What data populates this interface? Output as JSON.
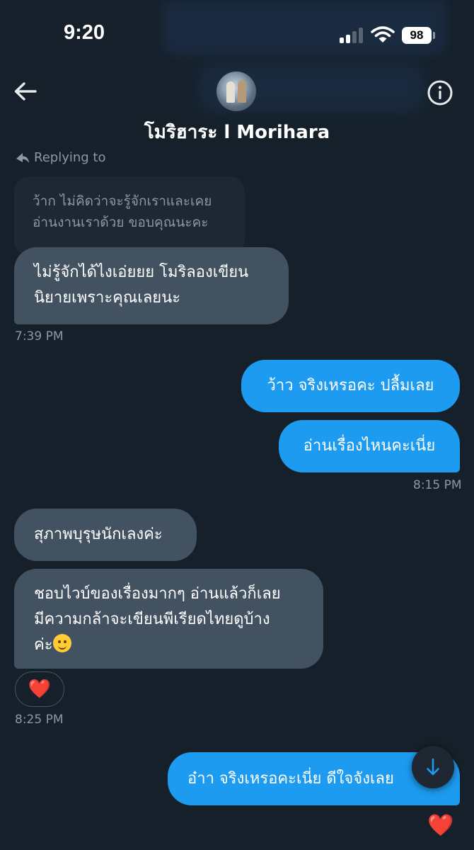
{
  "status_bar": {
    "time": "9:20",
    "battery": "98"
  },
  "header": {
    "contact_name": "โมริฮาระ l Morihara"
  },
  "reply": {
    "label": "Replying to",
    "quoted_lines": [
      "ว้าก ไม่คิดว่าจะรู้จักเราและเคย",
      "อ่านงานเราด้วย ขอบคุณนะคะ"
    ]
  },
  "messages": [
    {
      "lines": [
        "ไม่รู้จักได้ไงเอ่ยยย โมริลองเขียน",
        "นิยายเพราะคุณเลยนะ"
      ]
    },
    {
      "time": "7:39 PM"
    },
    {
      "text": "ว้าว จริงเหรอคะ ปลื้มเลย"
    },
    {
      "text": "อ่านเรื่องไหนคะเนี่ย",
      "time": "8:15 PM"
    },
    {
      "text": "สุภาพบุรุษนักเลงค่ะ"
    },
    {
      "lines": [
        "ชอบไวบ์ของเรื่องมากๆ อ่านแล้วก็เลย",
        "มีความกล้าจะเขียนพีเรียดไทยดูบ้าง",
        "ค่ะ"
      ],
      "reaction": "❤️",
      "time": "8:25 PM"
    },
    {
      "text": "อ๋าา จริงเหรอคะเนี่ย ดีใจจังเลย",
      "reaction": "❤️"
    }
  ],
  "icons": {
    "back": "arrow-left-icon",
    "info": "info-icon",
    "scroll_down": "arrow-down-icon",
    "reply": "reply-arrow-icon",
    "emoji": "smiling-face-emoji"
  },
  "colors": {
    "background": "#15202b",
    "incoming_bubble": "#435260",
    "outgoing_bubble": "#1d9bf0",
    "reaction_heart": "#f91880"
  }
}
